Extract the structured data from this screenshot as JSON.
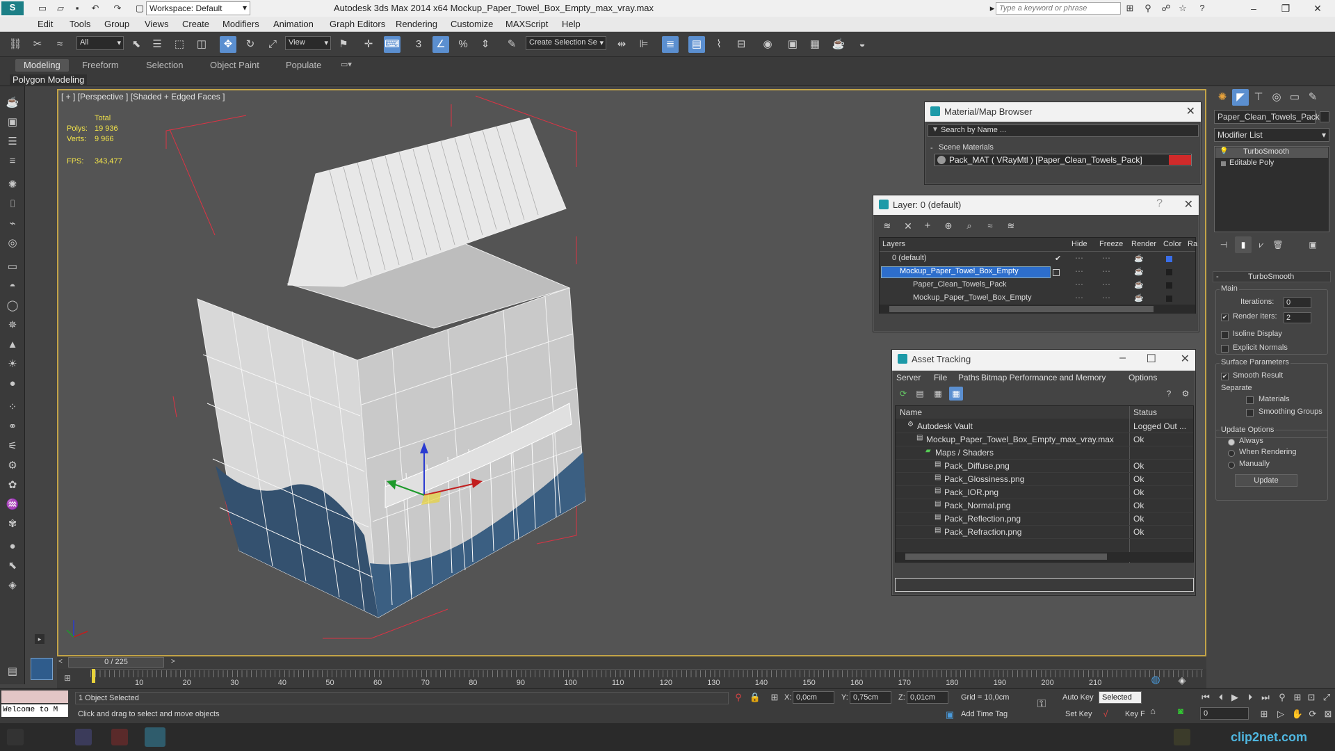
{
  "app": {
    "title": "Autodesk 3ds Max  2014 x64      Mockup_Paper_Towel_Box_Empty_max_vray.max",
    "workspace": "Workspace: Default",
    "search_placeholder": "Type a keyword or phrase"
  },
  "menu": [
    "Edit",
    "Tools",
    "Group",
    "Views",
    "Create",
    "Modifiers",
    "Animation",
    "Graph Editors",
    "Rendering",
    "Customize",
    "MAXScript",
    "Help"
  ],
  "toolbar": {
    "filter": "All",
    "ref_coord": "View",
    "selection_set": "Create Selection Se"
  },
  "ribbon": {
    "tabs": [
      "Modeling",
      "Freeform",
      "Selection",
      "Object Paint",
      "Populate"
    ],
    "active_tab": "Modeling",
    "sub": "Polygon Modeling"
  },
  "viewport": {
    "label": "[ + ] [Perspective ] [Shaded + Edged Faces ]",
    "stats": {
      "total_label": "Total",
      "polys_label": "Polys:",
      "polys": "19 936",
      "verts_label": "Verts:",
      "verts": "9 966",
      "fps_label": "FPS:",
      "fps": "343,477"
    }
  },
  "material_browser": {
    "title": "Material/Map Browser",
    "search": "Search by Name ...",
    "section": "Scene Materials",
    "item": "Pack_MAT  ( VRayMtl )  [Paper_Clean_Towels_Pack]",
    "swatch_color": "#d02a2a"
  },
  "layers": {
    "title": "Layer: 0 (default)",
    "columns": [
      "Layers",
      "Hide",
      "Freeze",
      "Render",
      "Color",
      "Ra"
    ],
    "rows": [
      {
        "name": "0 (default)",
        "indent": 0,
        "color": "#3a6ee8",
        "selected": false
      },
      {
        "name": "Mockup_Paper_Towel_Box_Empty",
        "indent": 0,
        "color": "#1e1e1e",
        "selected": true
      },
      {
        "name": "Paper_Clean_Towels_Pack",
        "indent": 1,
        "color": "#1e1e1e",
        "selected": false
      },
      {
        "name": "Mockup_Paper_Towel_Box_Empty",
        "indent": 1,
        "color": "#1e1e1e",
        "selected": false
      }
    ]
  },
  "asset_tracking": {
    "title": "Asset Tracking",
    "menu": [
      "Server",
      "File",
      "Paths",
      "Bitmap Performance and Memory",
      "Options"
    ],
    "columns": [
      "Name",
      "Status"
    ],
    "rows": [
      {
        "name": "Autodesk Vault",
        "status": "Logged Out ...",
        "indent": 1
      },
      {
        "name": "Mockup_Paper_Towel_Box_Empty_max_vray.max",
        "status": "Ok",
        "indent": 2
      },
      {
        "name": "Maps / Shaders",
        "status": "",
        "indent": 3
      },
      {
        "name": "Pack_Diffuse.png",
        "status": "Ok",
        "indent": 4
      },
      {
        "name": "Pack_Glossiness.png",
        "status": "Ok",
        "indent": 4
      },
      {
        "name": "Pack_IOR.png",
        "status": "Ok",
        "indent": 4
      },
      {
        "name": "Pack_Normal.png",
        "status": "Ok",
        "indent": 4
      },
      {
        "name": "Pack_Reflection.png",
        "status": "Ok",
        "indent": 4
      },
      {
        "name": "Pack_Refraction.png",
        "status": "Ok",
        "indent": 4
      }
    ]
  },
  "command_panel": {
    "object_name": "Paper_Clean_Towels_Pack",
    "modifier_list": "Modifier List",
    "stack": [
      "TurboSmooth",
      "Editable Poly"
    ],
    "rollout_title": "TurboSmooth",
    "main_label": "Main",
    "iterations_label": "Iterations:",
    "iterations": "0",
    "render_iters_label": "Render Iters:",
    "render_iters": "2",
    "isoline": "Isoline Display",
    "explicit_normals": "Explicit Normals",
    "surface_params": "Surface Parameters",
    "smooth_result": "Smooth Result",
    "separate": "Separate",
    "materials": "Materials",
    "smoothing_groups": "Smoothing Groups",
    "update_options": "Update Options",
    "always": "Always",
    "when_rendering": "When Rendering",
    "manually": "Manually",
    "update_button": "Update"
  },
  "timeline": {
    "frame": "0 / 225",
    "ticks": [
      "10",
      "20",
      "30",
      "40",
      "50",
      "60",
      "70",
      "80",
      "90",
      "100",
      "110",
      "120",
      "130",
      "140",
      "150",
      "160",
      "170",
      "180",
      "190",
      "200",
      "210"
    ]
  },
  "status": {
    "welcome": "Welcome to M",
    "selected": "1 Object Selected",
    "prompt": "Click and drag to select and move objects",
    "x_label": "X:",
    "x": "0,0cm",
    "y_label": "Y:",
    "y": "0,75cm",
    "z_label": "Z:",
    "z": "0,01cm",
    "grid": "Grid = 10,0cm",
    "auto_key": "Auto Key",
    "selected_dropdown": "Selected",
    "set_key": "Set Key",
    "key_filters": "Key F",
    "add_time_tag": "Add Time Tag",
    "frame_field": "0"
  },
  "watermark": "clip2net.com"
}
